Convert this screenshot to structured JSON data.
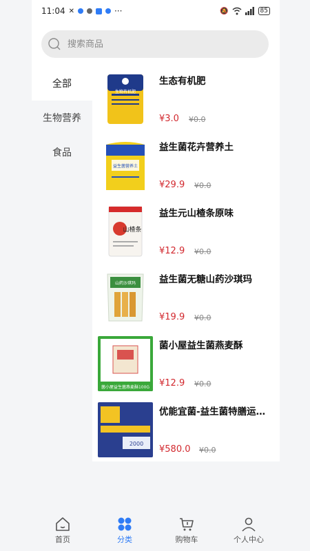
{
  "status_bar": {
    "time": "11:04",
    "extras": "···",
    "battery": "85"
  },
  "search": {
    "placeholder": "搜索商品"
  },
  "sidebar": {
    "items": [
      {
        "label": "全部"
      },
      {
        "label": "生物营养"
      },
      {
        "label": "食品"
      }
    ]
  },
  "products": [
    {
      "name": "生态有机肥",
      "price": "¥3.0",
      "original_price": "¥0.0",
      "thumb_text": "生物有机肥"
    },
    {
      "name": "益生菌花卉营养土",
      "price": "¥29.9",
      "original_price": "¥0.0",
      "thumb_text": "益生菌营养土"
    },
    {
      "name": "益生元山楂条原味",
      "price": "¥12.9",
      "original_price": "¥0.0",
      "thumb_text": "山楂条"
    },
    {
      "name": "益生菌无糖山药沙琪玛",
      "price": "¥19.9",
      "original_price": "¥0.0",
      "thumb_text": "山药沙琪玛"
    },
    {
      "name": "菌小屋益生菌燕麦酥",
      "price": "¥12.9",
      "original_price": "¥0.0",
      "thumb_text": "菌小屋益生菌燕麦酥100G"
    },
    {
      "name": "优能宜菌-益生菌特膳运…",
      "price": "¥580.0",
      "original_price": "¥0.0",
      "thumb_text": "2000"
    }
  ],
  "tabbar": {
    "home": "首页",
    "category": "分类",
    "cart": "购物车",
    "profile": "个人中心"
  },
  "colors": {
    "accent": "#2f7cf6",
    "price": "#d2282e",
    "background": "#f4f5f7"
  }
}
